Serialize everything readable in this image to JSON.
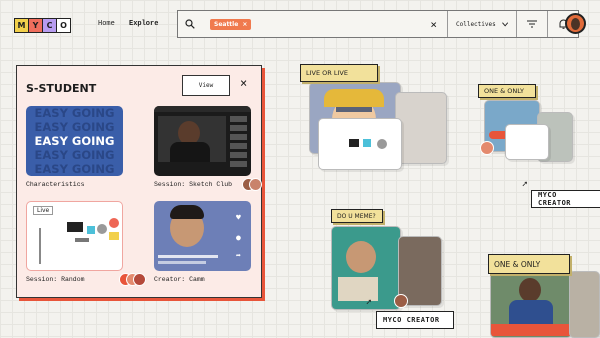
{
  "logo": {
    "letters": [
      "M",
      "Y",
      "C",
      "O"
    ],
    "colors": [
      "#f2d04b",
      "#ef6e5d",
      "#b79cf0",
      "#ffffff"
    ]
  },
  "nav": {
    "home": "Home",
    "explore": "Explore"
  },
  "search": {
    "chip": "Seattle",
    "chip_close": "×",
    "clear": "×",
    "collectives": "Collectives"
  },
  "panel": {
    "title": "S-STUDENT",
    "view_label": "View",
    "close": "×",
    "easy_going": "EASY GOING",
    "live_badge": "Live",
    "tiles": [
      {
        "caption": "Characteristics"
      },
      {
        "caption": "Session: Sketch Club"
      },
      {
        "caption": "Session: Random"
      },
      {
        "caption": "Creator: Camm"
      }
    ]
  },
  "canvas": {
    "live_label": "LIVE OR LIVE",
    "meme_label": "DO U MEME?",
    "one_only_small": "ONE & ONLY",
    "one_only_big": "ONE & ONLY",
    "cursor_tag_1": "MYCO CREATOR",
    "cursor_tag_2": "MYCO CREATOR"
  },
  "colors": {
    "accent": "#e8553a",
    "panel_bg": "#fcebe7",
    "label_bg": "#f2e19b",
    "tile_blue": "#3a5ea9"
  }
}
